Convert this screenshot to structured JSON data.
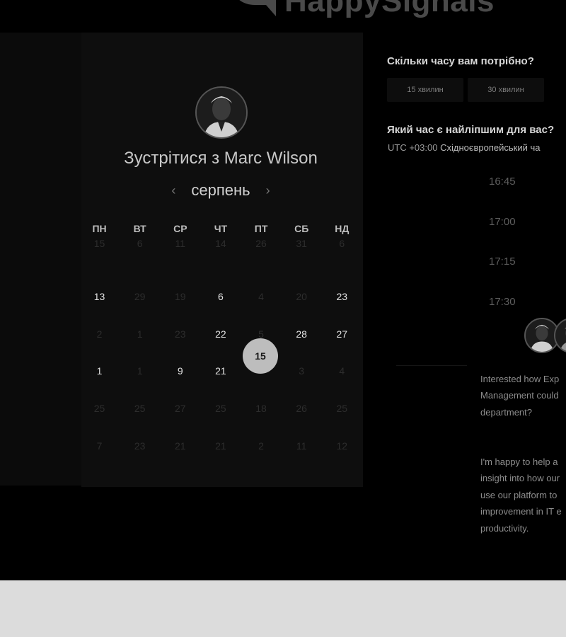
{
  "brand": {
    "name": "HappySignals"
  },
  "meeting": {
    "title": "Зустрітися з Marc Wilson",
    "month": "серпень",
    "weekdays": [
      "ПН",
      "ВТ",
      "СР",
      "ЧТ",
      "ПТ",
      "СБ",
      "НД"
    ],
    "weeks": [
      [
        {
          "d": "15",
          "a": false
        },
        {
          "d": "6",
          "a": false
        },
        {
          "d": "11",
          "a": false
        },
        {
          "d": "14",
          "a": false
        },
        {
          "d": "26",
          "a": false
        },
        {
          "d": "31",
          "a": false
        },
        {
          "d": "6",
          "a": false
        }
      ],
      [
        {
          "d": "13",
          "a": true
        },
        {
          "d": "29",
          "a": false
        },
        {
          "d": "19",
          "a": false
        },
        {
          "d": "6",
          "a": true
        },
        {
          "d": "4",
          "a": false
        },
        {
          "d": "20",
          "a": false
        },
        {
          "d": "23",
          "a": true
        }
      ],
      [
        {
          "d": "2",
          "a": false
        },
        {
          "d": "1",
          "a": false
        },
        {
          "d": "23",
          "a": false
        },
        {
          "d": "22",
          "a": true
        },
        {
          "d": "5",
          "a": false
        },
        {
          "d": "28",
          "a": true
        },
        {
          "d": "27",
          "a": true
        }
      ],
      [
        {
          "d": "1",
          "a": true
        },
        {
          "d": "1",
          "a": false
        },
        {
          "d": "9",
          "a": true
        },
        {
          "d": "21",
          "a": true
        },
        {
          "d": "",
          "a": false
        },
        {
          "d": "3",
          "a": false
        },
        {
          "d": "4",
          "a": false
        }
      ],
      [
        {
          "d": "25",
          "a": false
        },
        {
          "d": "25",
          "a": false
        },
        {
          "d": "27",
          "a": false
        },
        {
          "d": "25",
          "a": false
        },
        {
          "d": "18",
          "a": false
        },
        {
          "d": "26",
          "a": false
        },
        {
          "d": "25",
          "a": false
        }
      ],
      [
        {
          "d": "7",
          "a": false
        },
        {
          "d": "23",
          "a": false
        },
        {
          "d": "21",
          "a": false
        },
        {
          "d": "21",
          "a": false
        },
        {
          "d": "2",
          "a": false
        },
        {
          "d": "11",
          "a": false
        },
        {
          "d": "12",
          "a": false
        }
      ]
    ],
    "selected_day": "15"
  },
  "duration": {
    "question": "Скільки часу вам потрібно?",
    "options": [
      "15 хвилин",
      "30 хвилин"
    ]
  },
  "timepicker": {
    "question": "Який час є найліпшим для вас?",
    "tz_offset": "UTC +03:00",
    "tz_name": "Східноєвропейський ча",
    "slots": [
      "16:45",
      "17:00",
      "17:15",
      "17:30"
    ]
  },
  "bio": {
    "p1": "Interested how Exp\nManagement could\ndepartment?",
    "p2": "I'm happy to help a\ninsight into how our\nuse our platform to\nimprovement in IT e\nproductivity."
  }
}
